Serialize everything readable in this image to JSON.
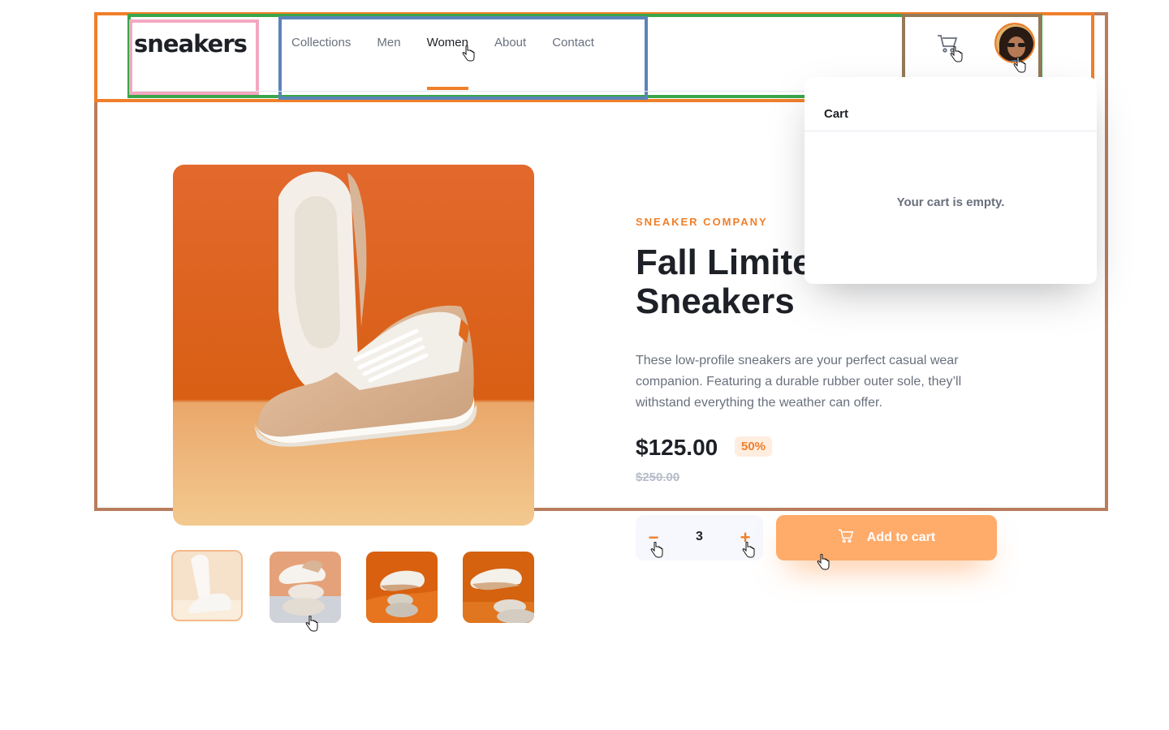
{
  "header": {
    "logo": "sneakers",
    "nav": [
      "Collections",
      "Men",
      "Women",
      "About",
      "Contact"
    ],
    "active_nav": "Women"
  },
  "cart": {
    "title": "Cart",
    "empty_message": "Your cart is empty."
  },
  "product": {
    "company": "SNEAKER COMPANY",
    "title": "Fall Limited Edition Sneakers",
    "description": "These low-profile sneakers are your perfect casual wear companion. Featuring a durable rubber outer sole, they’ll withstand everything the weather can offer.",
    "price": "$125.00",
    "discount": "50%",
    "old_price": "$250.00",
    "quantity": "3",
    "minus_label": "−",
    "plus_label": "+",
    "add_to_cart_label": "Add to cart"
  },
  "icons": {
    "cart": "cart-icon",
    "avatar": "avatar",
    "pointer": "hand-pointer-icon"
  },
  "colors": {
    "accent": "#f07f2a",
    "accent_light": "#ffede0",
    "button": "#ffab6a",
    "text_dark": "#1d2026",
    "text_muted": "#69707d"
  }
}
